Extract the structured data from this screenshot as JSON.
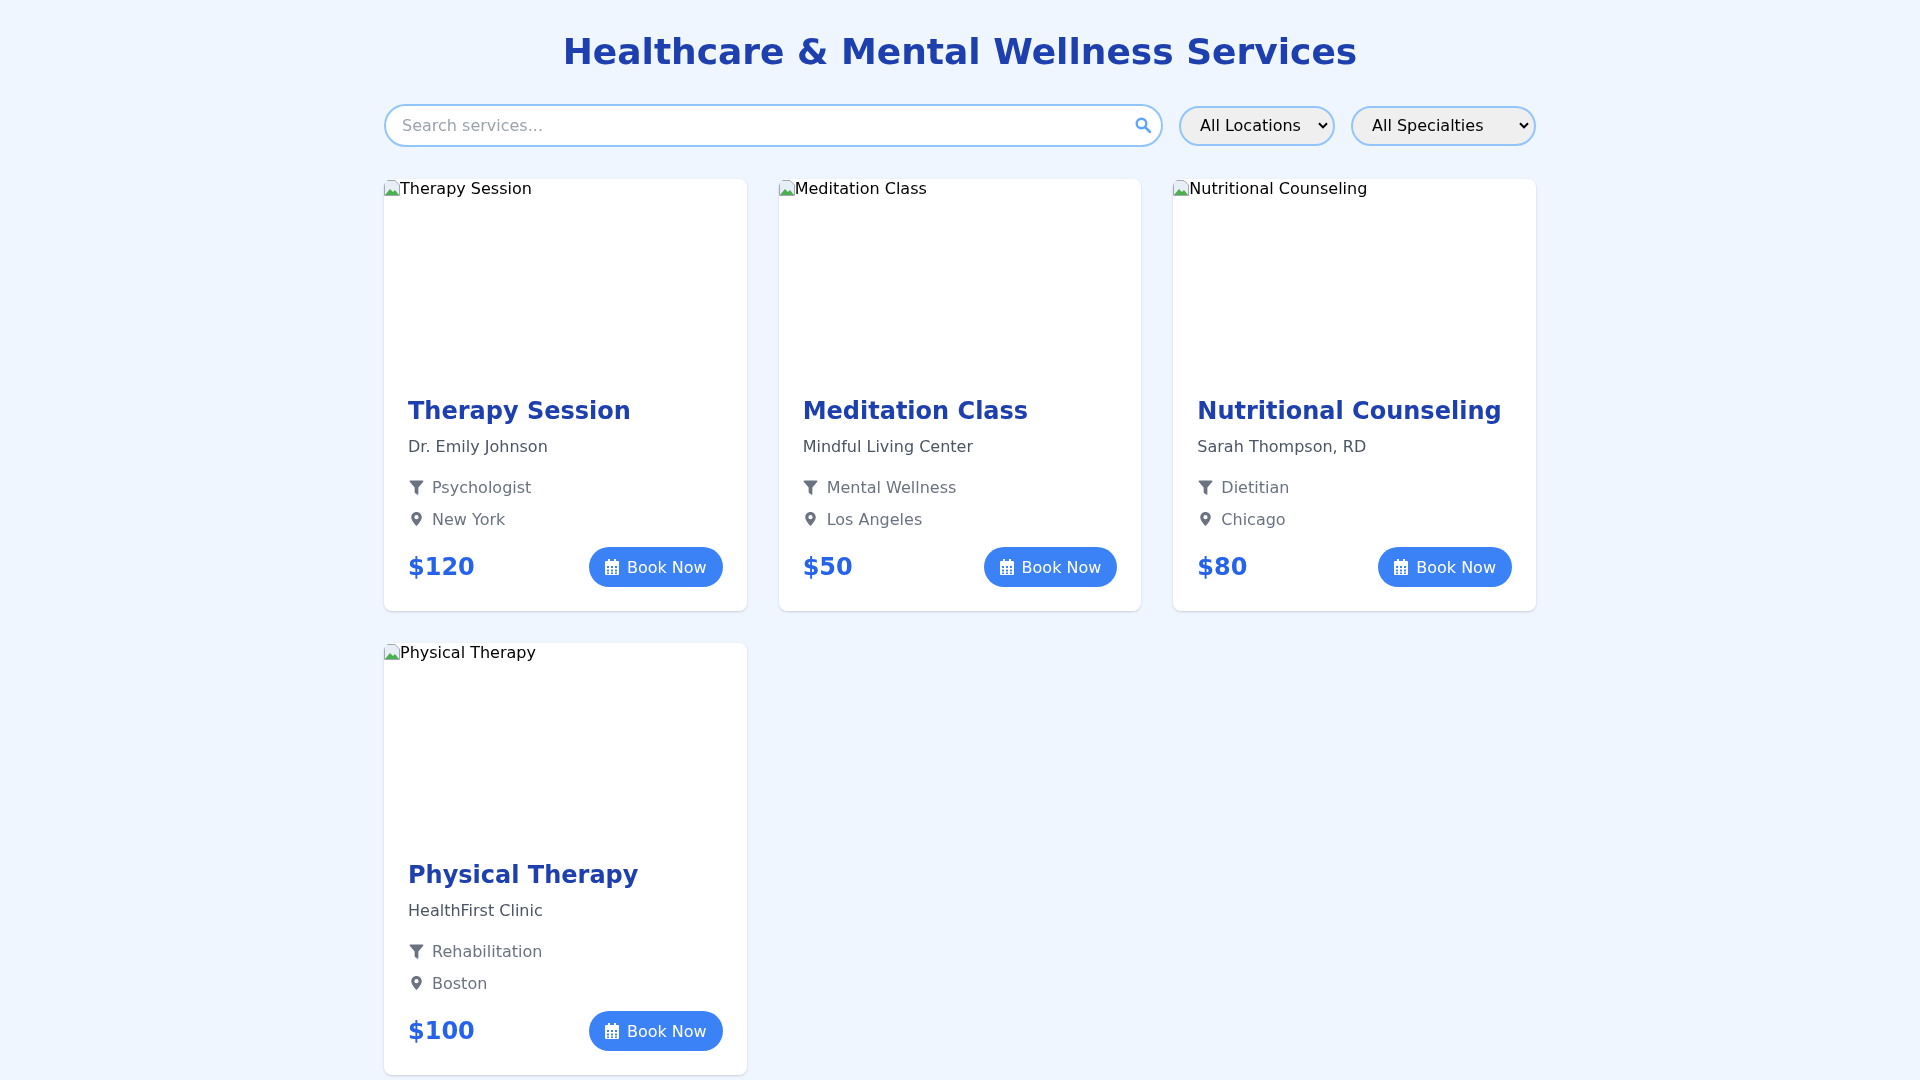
{
  "page_title": "Healthcare & Mental Wellness Services",
  "filters": {
    "search": {
      "placeholder": "Search services..."
    },
    "dropdowns": [
      {
        "value": "All Locations"
      },
      {
        "value": "All Specialties"
      }
    ]
  },
  "services": [
    {
      "image_alt": "Therapy Session",
      "title": "Therapy Session",
      "provider": "Dr. Emily Johnson",
      "specialty": "Psychologist",
      "location": "New York",
      "price": "$120",
      "button": "Book Now"
    },
    {
      "image_alt": "Meditation Class",
      "title": "Meditation Class",
      "provider": "Mindful Living Center",
      "specialty": "Mental Wellness",
      "location": "Los Angeles",
      "price": "$50",
      "button": "Book Now"
    },
    {
      "image_alt": "Nutritional Counseling",
      "title": "Nutritional Counseling",
      "provider": "Sarah Thompson, RD",
      "specialty": "Dietitian",
      "location": "Chicago",
      "price": "$80",
      "button": "Book Now"
    },
    {
      "image_alt": "Physical Therapy",
      "title": "Physical Therapy",
      "provider": "HealthFirst Clinic",
      "specialty": "Rehabilitation",
      "location": "Boston",
      "price": "$100",
      "button": "Book Now"
    }
  ]
}
